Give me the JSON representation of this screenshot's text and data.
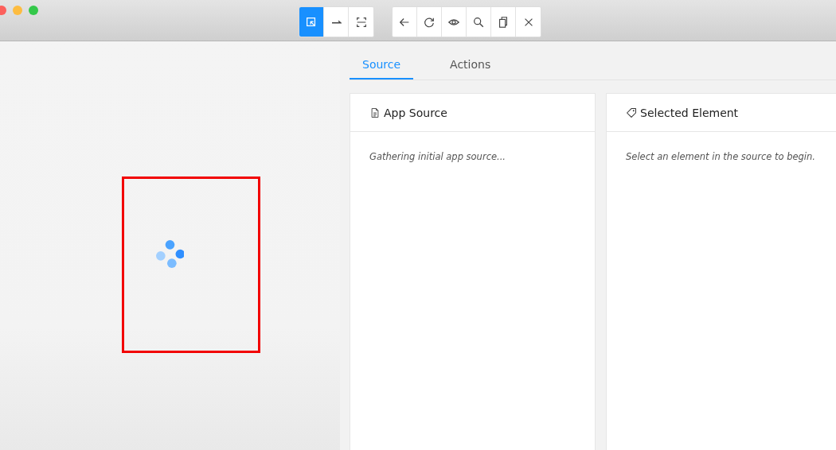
{
  "toolbar": {
    "groups": [
      {
        "buttons": [
          {
            "kind": "select",
            "selected": true
          },
          {
            "kind": "swipe",
            "selected": false
          },
          {
            "kind": "tap",
            "selected": false
          }
        ]
      },
      {
        "buttons": [
          {
            "kind": "back",
            "selected": false
          },
          {
            "kind": "refresh",
            "selected": false
          },
          {
            "kind": "eye",
            "selected": false
          },
          {
            "kind": "search",
            "selected": false
          },
          {
            "kind": "copy",
            "selected": false
          },
          {
            "kind": "close",
            "selected": false
          }
        ]
      }
    ]
  },
  "tabs": [
    {
      "label": "Source",
      "selected": true
    },
    {
      "label": "Actions",
      "selected": false
    }
  ],
  "cards": [
    {
      "kind": "file",
      "title": "App Source",
      "message": "Gathering initial app source..."
    },
    {
      "kind": "tag",
      "title": "Selected Element",
      "message": "Select an element in the source to begin."
    }
  ]
}
